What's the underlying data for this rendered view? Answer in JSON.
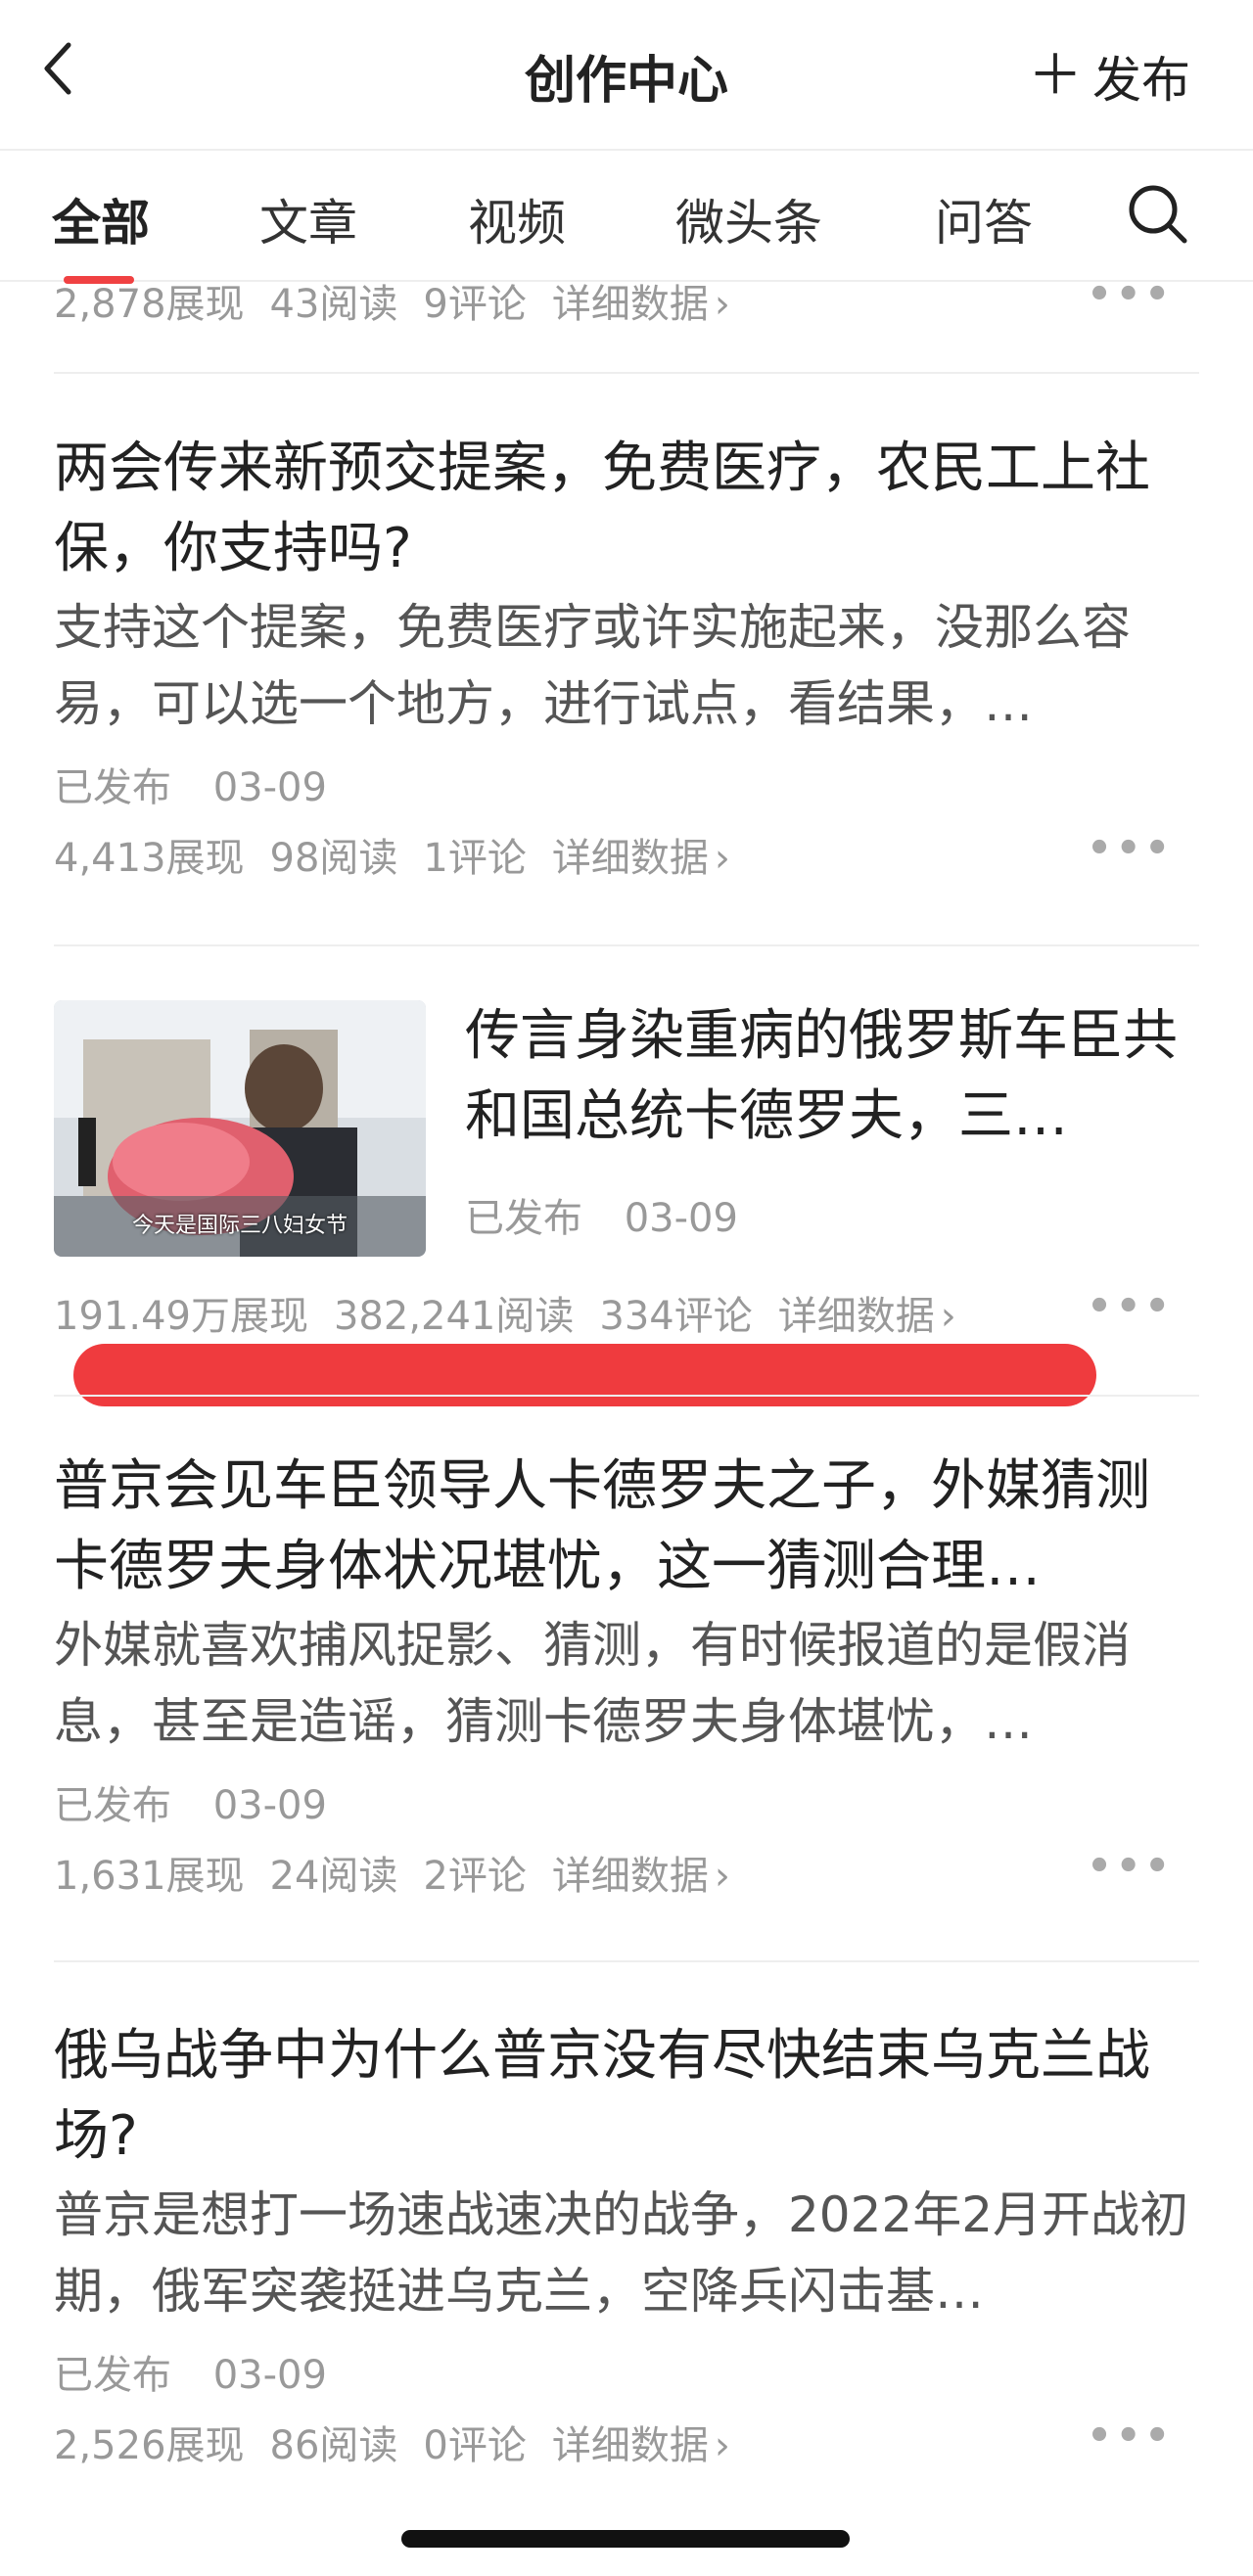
{
  "header": {
    "title": "创作中心",
    "publish_label": "发布"
  },
  "tabs": [
    {
      "label": "全部",
      "active": true
    },
    {
      "label": "文章"
    },
    {
      "label": "视频"
    },
    {
      "label": "微头条"
    },
    {
      "label": "问答"
    }
  ],
  "partial_item": {
    "views": "2,878展现",
    "reads": "43阅读",
    "comments": "9评论",
    "detail": "详细数据"
  },
  "items": [
    {
      "title": "两会传来新预交提案，免费医疗，农民工上社保，你支持吗?",
      "summary": "支持这个提案，免费医疗或许实施起来，没那么容易，可以选一个地方，进行试点，看结果，…",
      "status": "已发布",
      "date": "03-09",
      "views": "4,413展现",
      "reads": "98阅读",
      "comments": "1评论",
      "detail": "详细数据"
    },
    {
      "title": "传言身染重病的俄罗斯车臣共和国总统卡德罗夫，三…",
      "thumbnail_caption": "今天是国际三八妇女节",
      "status": "已发布",
      "date": "03-09",
      "views": "191.49万展现",
      "reads": "382,241阅读",
      "comments": "334评论",
      "detail": "详细数据"
    },
    {
      "title": "普京会见车臣领导人卡德罗夫之子，外媒猜测卡德罗夫身体状况堪忧，这一猜测合理…",
      "summary": "外媒就喜欢捕风捉影、猜测，有时候报道的是假消息，甚至是造谣，猜测卡德罗夫身体堪忧，…",
      "status": "已发布",
      "date": "03-09",
      "views": "1,631展现",
      "reads": "24阅读",
      "comments": "2评论",
      "detail": "详细数据"
    },
    {
      "title": "俄乌战争中为什么普京没有尽快结束乌克兰战场?",
      "summary": "普京是想打一场速战速决的战争，2022年2月开战初期，俄军突袭挺进乌克兰，空降兵闪击基…",
      "status": "已发布",
      "date": "03-09",
      "views": "2,526展现",
      "reads": "86阅读",
      "comments": "0评论",
      "detail": "详细数据"
    }
  ],
  "icons": {
    "back": "chevron-left-icon",
    "search": "search-icon",
    "more": "more-dots-icon",
    "chevron": "chevron-right-icon"
  },
  "colors": {
    "accent": "#f04142",
    "highlight_bar": "#ef3b3e"
  }
}
